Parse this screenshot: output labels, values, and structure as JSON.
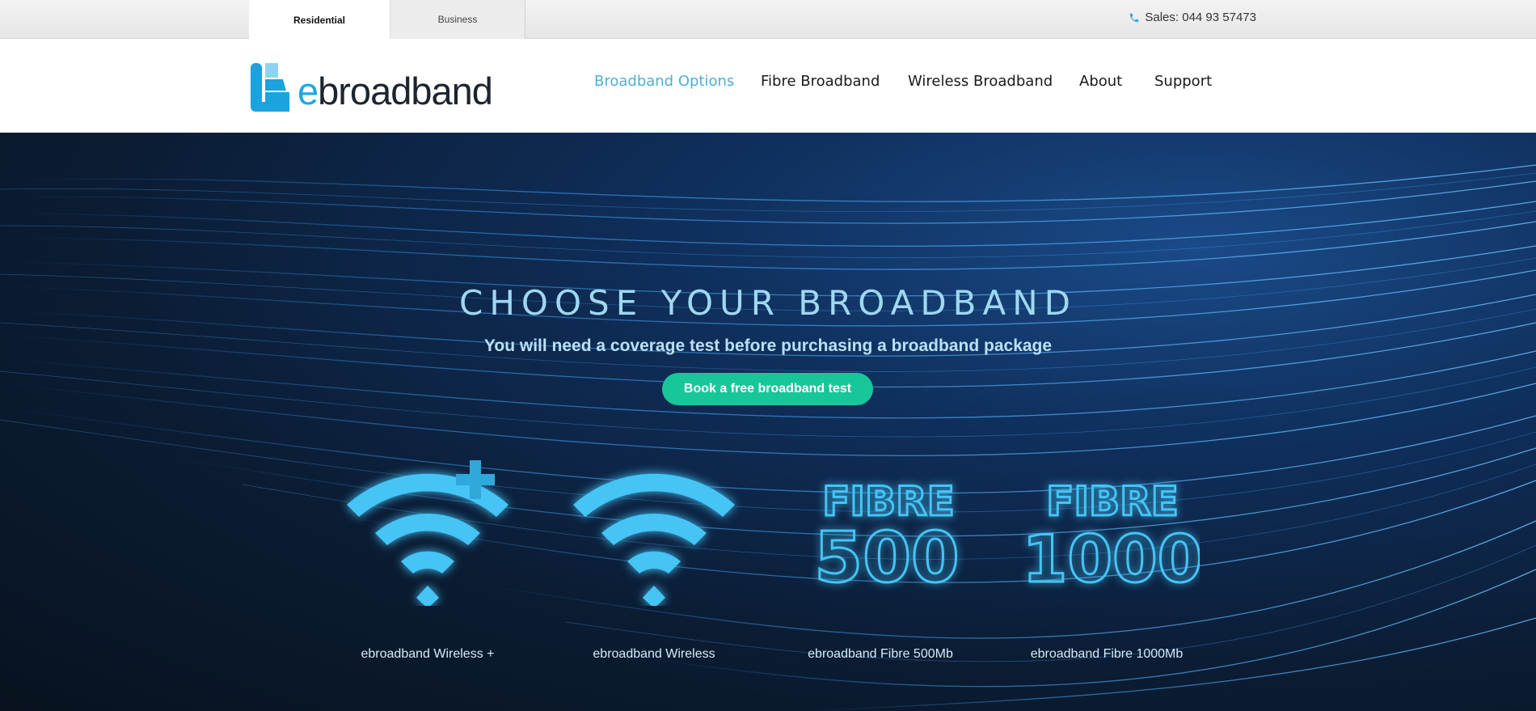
{
  "topbar": {
    "tabs": [
      "Residential",
      "Business"
    ],
    "active_tab": "Residential",
    "sales_label": "Sales: 044 93 57473",
    "phone_icon": "phone-icon"
  },
  "header": {
    "logo_e": "e",
    "logo_rest": "broadband",
    "nav": [
      {
        "label": "Broadband Options",
        "active": true
      },
      {
        "label": "Fibre Broadband",
        "active": false
      },
      {
        "label": "Wireless Broadband",
        "active": false
      },
      {
        "label": "About",
        "active": false
      },
      {
        "label": "Support",
        "active": false
      }
    ]
  },
  "hero": {
    "title": "CHOOSE YOUR BROADBAND",
    "subtitle": "You will need a coverage test before purchasing a broadband package",
    "cta_label": "Book a free broadband test"
  },
  "products": [
    {
      "label": "ebroadband Wireless +",
      "icon": "wifi-plus-icon"
    },
    {
      "label": "ebroadband Wireless",
      "icon": "wifi-icon"
    },
    {
      "label": "ebroadband Fibre 500Mb",
      "icon": "fibre-500-icon",
      "word": "FIBRE",
      "number": "500"
    },
    {
      "label": "ebroadband Fibre 1000Mb",
      "icon": "fibre-1000-icon",
      "word": "FIBRE",
      "number": "1000"
    }
  ],
  "colors": {
    "accent": "#4eaed8",
    "cta": "#17c79a",
    "icon_blue": "#45c4f5"
  }
}
